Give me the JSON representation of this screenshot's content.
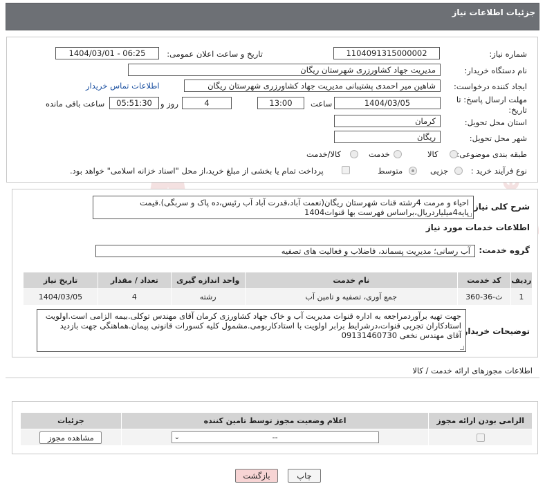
{
  "header": {
    "title": "جزئیات اطلاعات نیاز"
  },
  "fields": {
    "need_number_label": "شماره نیاز:",
    "need_number": "1104091315000002",
    "announce_label": "تاریخ و ساعت اعلان عمومی:",
    "announce_value": "1404/03/01 - 06:25",
    "buyer_org_label": "نام دستگاه خریدار:",
    "buyer_org": "مدیریت جهاد کشاورزری شهرستان ریگان",
    "creator_label": "ایجاد کننده درخواست:",
    "creator": "شاهین  میر احمدی پشتیبانی مدیریت جهاد کشاورزری شهرستان ریگان",
    "buyer_contact_link": "اطلاعات تماس خریدار",
    "deadline_label_1": "مهلت ارسال پاسخ: تا",
    "deadline_label_2": "تاریخ:",
    "deadline_date": "1404/03/05",
    "hour_label": "ساعت",
    "deadline_time": "13:00",
    "days_value": "4",
    "days_label": "روز و",
    "remaining_time": "05:51:30",
    "remaining_label": "ساعت باقی مانده",
    "province_label": "استان محل تحویل:",
    "province": "کرمان",
    "city_label": "شهر محل تحویل:",
    "city": "ریگان",
    "category_label": "طبقه بندی موضوعی:",
    "category_options": [
      "کالا",
      "خدمت",
      "کالا/خدمت"
    ],
    "category_selected": "خدمت",
    "purchase_type_label": "نوع فرآیند خرید :",
    "purchase_options": [
      "جزیی",
      "متوسط"
    ],
    "purchase_selected": "متوسط",
    "treasury_note": "پرداخت تمام یا بخشی از مبلغ خرید،از محل \"اسناد خزانه اسلامی\" خواهد بود."
  },
  "description": {
    "label": "شرح کلی نیاز:",
    "text_line1": "احیاء و مرمت 4رشته قنات شهرستان ریگان(نعمت آباد،قدرت آباد آب رئیس،ده پاک و سربگی).قیمت",
    "text_line2": "پایه4میلیاردریال،براساس فهرست بها قنوات1404"
  },
  "services": {
    "section_title": "اطلاعات خدمات مورد نیاز",
    "group_label": "گروه خدمت:",
    "group_value": "آب رسانی؛ مدیریت پسماند، فاضلاب و فعالیت های تصفیه",
    "table_headers": [
      "ردیف",
      "کد خدمت",
      "نام خدمت",
      "واحد اندازه گیری",
      "تعداد / مقدار",
      "تاریخ نیاز"
    ],
    "rows": [
      [
        "1",
        "ث-36-360",
        "جمع آوری، تصفیه و تامین آب",
        "رشته",
        "4",
        "1404/03/05"
      ]
    ]
  },
  "buyer_notes": {
    "label": "توضیحات خریدار:",
    "line1": "جهت تهیه برآوردمراجعه به اداره قنوات مدیریت آب و خاک جهاد کشاورزی کرمان آقای مهندس توکلی.بیمه الزامی است.اولویت",
    "line2": "استادکاران تجربی قنوات،درشرایط برابر اولویت با استادکاربومی.مشمول کلیه کسورات قانونی پیمان.هماهنگی جهت بازدید",
    "line3": "آقای مهندس نخعی 09131460730"
  },
  "permits": {
    "section_title": "اطلاعات مجوزهای ارائه خدمت / کالا",
    "headers": [
      "الزامی بودن ارائه مجوز",
      "اعلام وضعیت مجوز توسط تامین کننده",
      "جزئیات"
    ],
    "select_value": "--",
    "view_button": "مشاهده مجوز"
  },
  "footer": {
    "print_button": "چاپ",
    "back_button": "بازگشت"
  },
  "watermark": "AriaTender.neT",
  "colors": {
    "header_bg": "#6d7075",
    "table_header_bg": "#d4d4d4",
    "link": "#1a4fa0",
    "back_btn_bg": "#f7d4d4"
  }
}
